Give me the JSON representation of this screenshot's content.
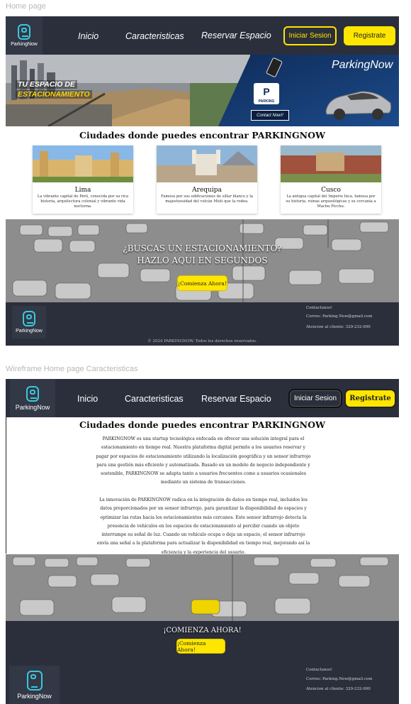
{
  "frames": {
    "home_label": "Home page",
    "wireframe_label": "Wireframe Home page Caracteristicas"
  },
  "brand": {
    "name": "ParkingNow",
    "accent": "#ffe600",
    "dark": "#2b2f3b",
    "logo_color": "#3cc7dc"
  },
  "nav": {
    "items": [
      "Inicio",
      "Caracteristicas",
      "Reservar Espacio"
    ],
    "login_label": "Iniciar Sesion",
    "register_label": "Registrate"
  },
  "banner": {
    "tagline_1": "TU ESPACIO DE",
    "tagline_2": "ESTACIONAMIENTO",
    "brand": "ParkingNow",
    "sign_main": "P",
    "sign_sub": "PARKING",
    "contact": "Contact Now!!"
  },
  "cities": {
    "title": "Ciudades donde puedes encontrar PARKINGNOW",
    "items": [
      {
        "name": "Lima",
        "desc": "La vibrante capital de Perú, conocida por su rica historia, arquitectura colonial y vibrante vida nocturna."
      },
      {
        "name": "Arequipa",
        "desc": "Famosa por sus edificaciones de sillar blanco y la majestuosidad del volcán Misti que la rodea."
      },
      {
        "name": "Cusco",
        "desc": "La antigua capital del Imperio Inca, famosa por su historia, ruinas arqueológicas y su cercanía a Machu Picchu."
      }
    ]
  },
  "cta": {
    "line1": "¿BUSCAS UN ESTACIONAMIENTO?",
    "line2": "HAZLO AQUI EN SEGUNDOS",
    "button": "¡Comienza Ahora!"
  },
  "footer": {
    "contact_title": "Contactanos!",
    "email": "Correo: Parking.Now@gmail.com",
    "phone": "Atencion al cliente: 329-232-000",
    "copyright": "© 2024 PARKINGNOW. Todos los derechos reservados."
  },
  "wireframe": {
    "title": "Ciudades donde puedes encontrar PARKINGNOW",
    "paragraph_1": "PARKINGNOW es una startup tecnológica enfocada en ofrecer una solución integral para el estacionamiento en tiempo real. Nuestra plataforma digital permite a los usuarios reservar y pagar por espacios de estacionamiento utilizando la localización geográfica y un sensor infrarrojo para una gestión más eficiente y automatizada. Basado en un modelo de negocio independiente y sostenible, PARKINGNOW se adapta tanto a usuarios frecuentes como a usuarios ocasionales mediante un sistema de transacciones.",
    "paragraph_2": "La innovación de PARKINGNOW radica en la integración de datos en tiempo real, incluidos los datos proporcionados por un sensor infrarrojo, para garantizar la disponibilidad de espacios y optimizar las rutas hacia los estacionamientos más cercanos. Este sensor infrarrojo detecta la presencia de vehículos en los espacios de estacionamiento al percibir cuando un objeto interrumpe su señal de luz. Cuando un vehículo ocupa o deja un espacio, el sensor infrarrojo envía una señal a la plataforma para actualizar la disponibilidad en tiempo real, mejorando así la eficiencia y la experiencia del usuario.",
    "cta_title": "¡COMIENZA AHORA!",
    "cta_button": "¡Comienza Ahora!"
  }
}
